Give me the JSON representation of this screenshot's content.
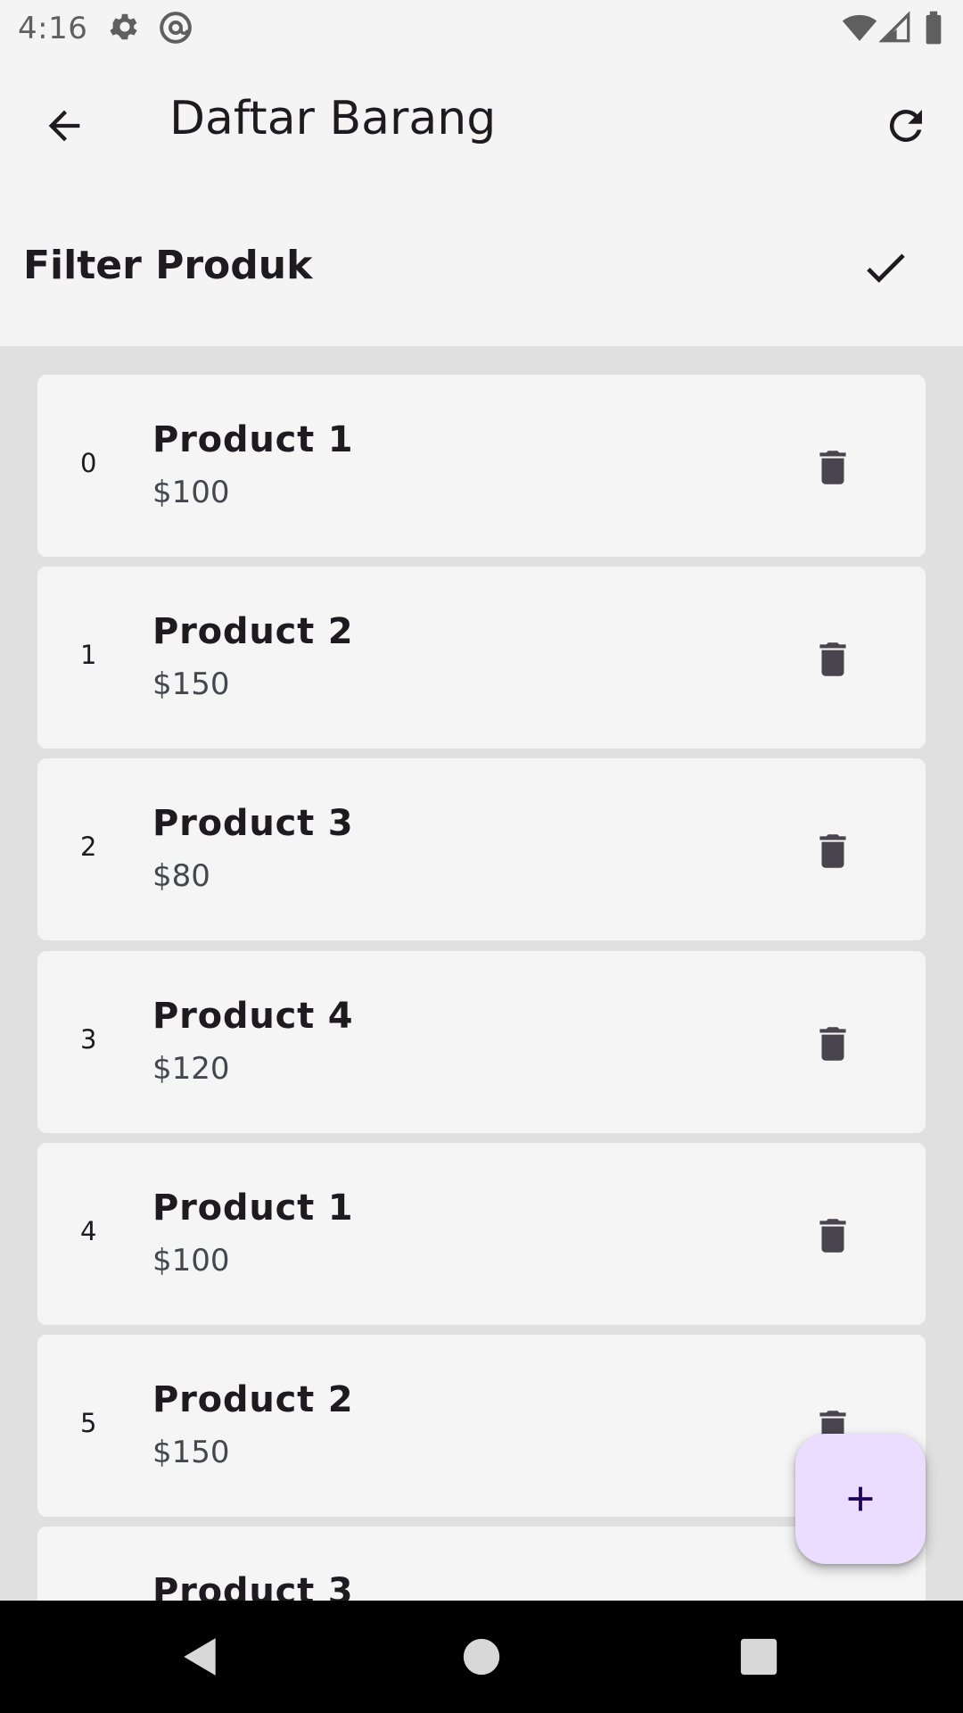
{
  "status_bar": {
    "time": "4:16",
    "icons": [
      "settings-icon",
      "at-sign-icon",
      "wifi-icon",
      "cellular-signal-icon",
      "battery-icon"
    ]
  },
  "app_bar": {
    "title": "Daftar Barang",
    "back_icon": "arrow-back-icon",
    "refresh_icon": "refresh-icon"
  },
  "filter": {
    "label": "Filter Produk",
    "apply_icon": "check-icon"
  },
  "products": [
    {
      "index": "0",
      "name": "Product 1",
      "price": "$100"
    },
    {
      "index": "1",
      "name": "Product 2",
      "price": "$150"
    },
    {
      "index": "2",
      "name": "Product 3",
      "price": "$80"
    },
    {
      "index": "3",
      "name": "Product 4",
      "price": "$120"
    },
    {
      "index": "4",
      "name": "Product 1",
      "price": "$100"
    },
    {
      "index": "5",
      "name": "Product 2",
      "price": "$150"
    },
    {
      "index": "",
      "name": "Product 3",
      "price": ""
    }
  ],
  "fab": {
    "icon": "add-icon"
  },
  "nav_bar": {
    "icons": [
      "nav-back-icon",
      "nav-home-icon",
      "nav-recents-icon"
    ]
  },
  "colors": {
    "background": "#f4f4f4",
    "list_background": "#e0e0e0",
    "card": "#f5f5f5",
    "fab": "#eaddff",
    "fab_icon": "#21005d",
    "delete_icon": "#49454f"
  }
}
